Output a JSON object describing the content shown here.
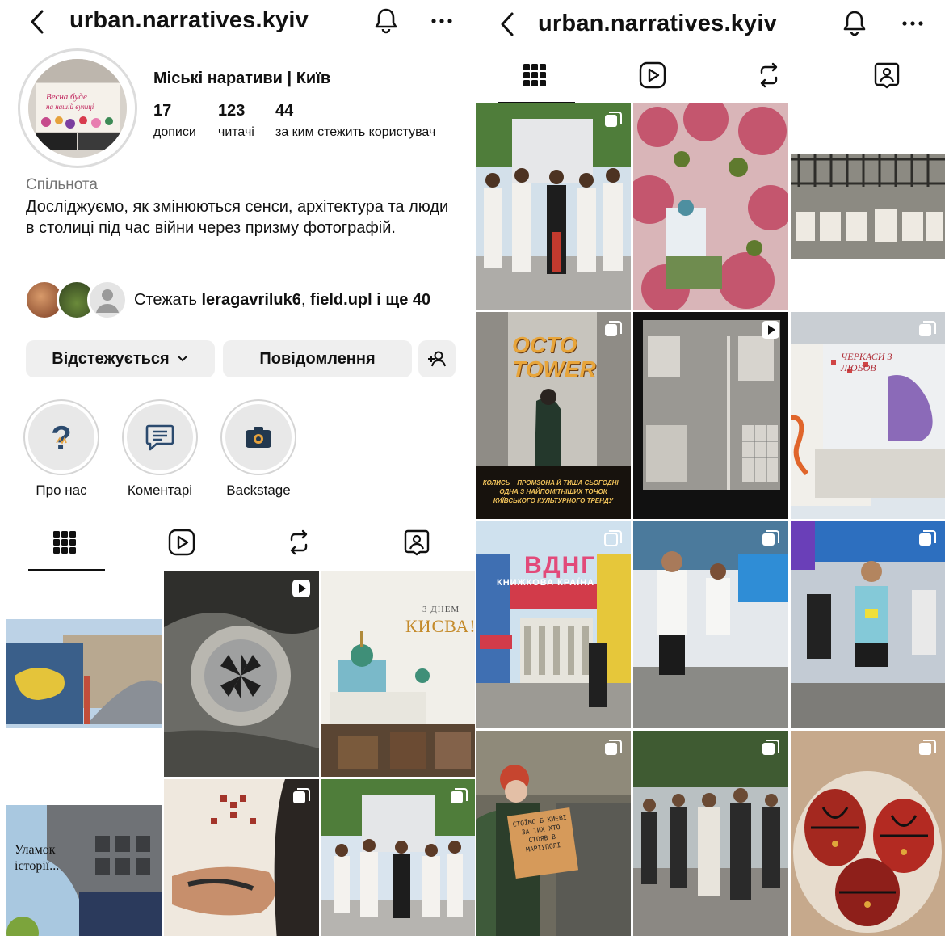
{
  "profile": {
    "username": "urban.narratives.kyiv",
    "display_name": "Міські наративи | Київ",
    "stats": [
      {
        "value": "17",
        "label": "дописи"
      },
      {
        "value": "123",
        "label": "читачі"
      },
      {
        "value": "44",
        "label": "за ким стежить користувач"
      }
    ],
    "category": "Спільнота",
    "bio": "Досліджуємо, як змінюються сенси, архітектура та люди в столиці під час війни через призму фотографій.",
    "followed_by": {
      "prefix": "Стежать",
      "user1": "leragavriluk6",
      "sep": ",",
      "user2": "field.upl",
      "suffix": "і ще 40"
    }
  },
  "buttons": {
    "following": "Відстежується",
    "message": "Повідомлення"
  },
  "highlights": [
    {
      "label": "Про нас",
      "icon": "question-icon"
    },
    {
      "label": "Коментарі",
      "icon": "comment-icon"
    },
    {
      "label": "Backstage",
      "icon": "camera-icon"
    }
  ],
  "tabs": [
    "grid-icon",
    "reels-icon",
    "reposts-icon",
    "tagged-icon"
  ],
  "posts_left": {
    "p2_kyiv_greeting": {
      "line1": "З ДНЕМ",
      "line2": "КИЄВА!"
    },
    "p4_caption": {
      "line1": "Уламок",
      "line2": "історії..."
    }
  },
  "posts_right": {
    "octo": {
      "title1": "OCTO",
      "title2": "TOWER",
      "caption": "КОЛИСЬ – ПРОМЗОНА Й ТИША СЬОГОДНІ – ОДНА З НАЙПОМІТНІШИХ ТОЧОК КИЇВСЬКОГО КУЛЬТУРНОГО ТРЕНДУ"
    },
    "book": {
      "title": "КНИЖКОВА КРАЇНА",
      "logo": "ВДНГ"
    },
    "sign": {
      "text": "СТОЇМО Б КИЄВІ ЗА ТИХ ХТО СТОЯВ В МАРІУПОЛІ"
    },
    "art": {
      "text": "ЧЕРКАСИ З ЛЮБОВ"
    }
  },
  "colors": {
    "accent": "#111111",
    "button_bg": "#efefef",
    "muted": "#737373"
  }
}
